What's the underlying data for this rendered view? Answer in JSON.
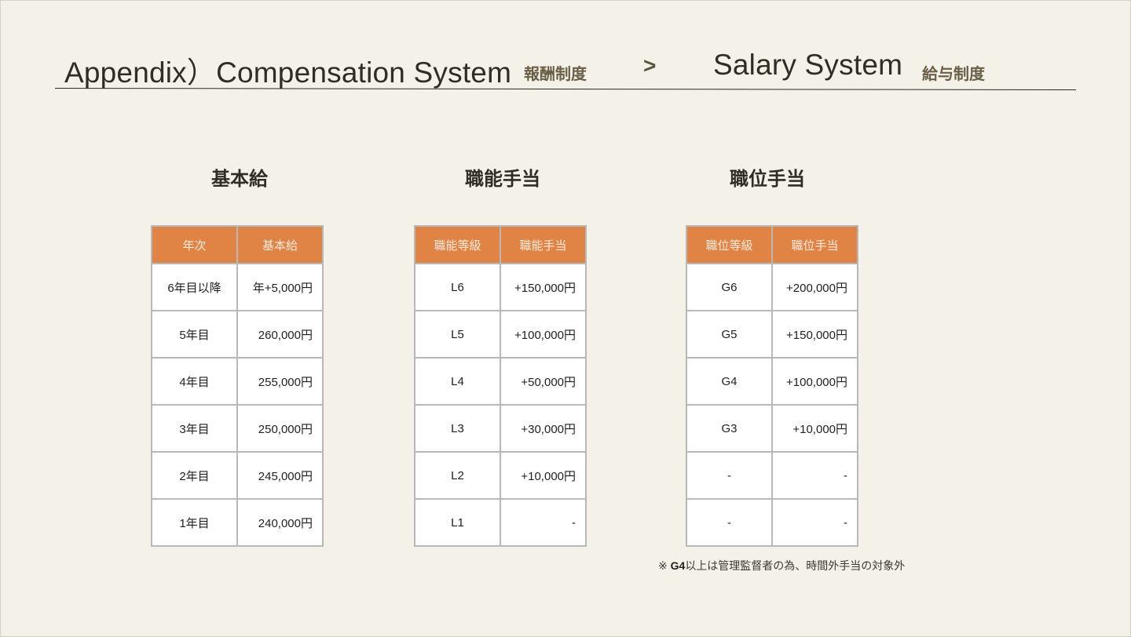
{
  "header": {
    "title_left": "Appendix）Compensation System",
    "sub_left": "報酬制度",
    "arrow": ">",
    "title_right": "Salary System",
    "sub_right": "給与制度"
  },
  "base_salary": {
    "title": "基本給",
    "columns": [
      "年次",
      "基本給"
    ],
    "rows": [
      [
        "6年目以降",
        "年+5,000円"
      ],
      [
        "5年目",
        "260,000円"
      ],
      [
        "4年目",
        "255,000円"
      ],
      [
        "3年目",
        "250,000円"
      ],
      [
        "2年目",
        "245,000円"
      ],
      [
        "1年目",
        "240,000円"
      ]
    ]
  },
  "skill_allowance": {
    "title": "職能手当",
    "columns": [
      "職能等級",
      "職能手当"
    ],
    "rows": [
      [
        "L6",
        "+150,000円"
      ],
      [
        "L5",
        "+100,000円"
      ],
      [
        "L4",
        "+50,000円"
      ],
      [
        "L3",
        "+30,000円"
      ],
      [
        "L2",
        "+10,000円"
      ],
      [
        "L1",
        "-"
      ]
    ]
  },
  "position_allowance": {
    "title": "職位手当",
    "columns": [
      "職位等級",
      "職位手当"
    ],
    "rows": [
      [
        "G6",
        "+200,000円"
      ],
      [
        "G5",
        "+150,000円"
      ],
      [
        "G4",
        "+100,000円"
      ],
      [
        "G3",
        "+10,000円"
      ],
      [
        "-",
        "-"
      ],
      [
        "-",
        "-"
      ]
    ]
  },
  "note": {
    "prefix": "※ ",
    "bold": "G4",
    "text": "以上は管理監督者の為、時間外手当の対象外"
  },
  "colors": {
    "background": "#f3f1e8",
    "header_cell": "#e08446",
    "header_text": "#fbe9dc",
    "cell_border": "#b8b8b8"
  }
}
